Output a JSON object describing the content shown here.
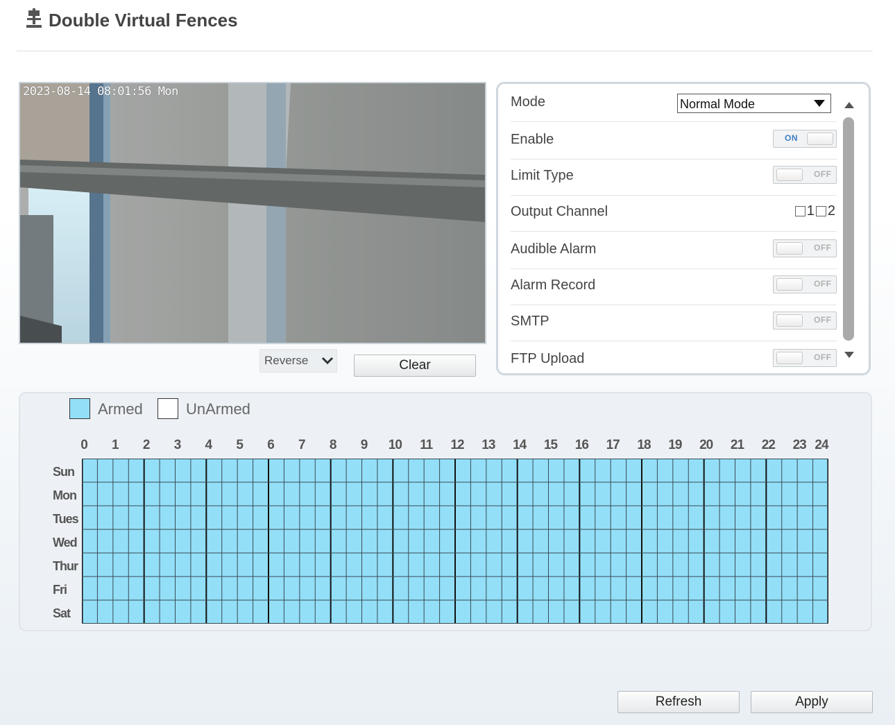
{
  "header": {
    "title": "Double Virtual Fences",
    "icon": "camera-sign-icon"
  },
  "video": {
    "osd_text": "2023-08-14 08:01:56 Mon"
  },
  "controls": {
    "reverse_label": "Reverse",
    "clear_label": "Clear"
  },
  "settings": {
    "mode": {
      "label": "Mode",
      "value": "Normal Mode"
    },
    "enable": {
      "label": "Enable",
      "state": "ON"
    },
    "limit_type": {
      "label": "Limit Type",
      "state": "OFF"
    },
    "output_channel": {
      "label": "Output Channel",
      "options": [
        "1",
        "2"
      ]
    },
    "audible_alarm": {
      "label": "Audible Alarm",
      "state": "OFF"
    },
    "alarm_record": {
      "label": "Alarm Record",
      "state": "OFF"
    },
    "smtp": {
      "label": "SMTP",
      "state": "OFF"
    },
    "ftp_upload": {
      "label": "FTP Upload",
      "state": "OFF"
    }
  },
  "schedule": {
    "legend": {
      "armed": "Armed",
      "unarmed": "UnArmed",
      "armed_color": "#93dff8",
      "unarmed_color": "#ffffff"
    },
    "hours": [
      "0",
      "1",
      "2",
      "3",
      "4",
      "5",
      "6",
      "7",
      "8",
      "9",
      "10",
      "11",
      "12",
      "13",
      "14",
      "15",
      "16",
      "17",
      "18",
      "19",
      "20",
      "21",
      "22",
      "23",
      "24"
    ],
    "days": [
      "Sun",
      "Mon",
      "Tues",
      "Wed",
      "Thur",
      "Fri",
      "Sat"
    ],
    "state": "all-armed"
  },
  "footer": {
    "refresh_label": "Refresh",
    "apply_label": "Apply"
  }
}
